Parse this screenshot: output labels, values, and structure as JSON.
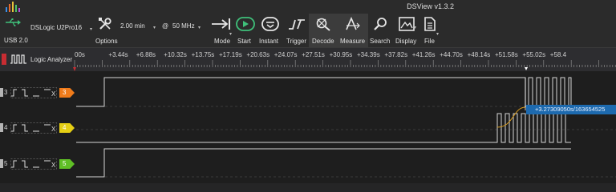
{
  "window": {
    "title": "DSView v1.3.2"
  },
  "device": {
    "name": "DSLogic U2Pro16",
    "connection": "USB 2.0"
  },
  "toolbar": {
    "options_label": "Options",
    "duration": "2.00 min",
    "at_sign": "@",
    "sample_rate": "50 MHz",
    "mode_label": "Mode",
    "start_label": "Start",
    "instant_label": "Instant",
    "trigger_label": "Trigger",
    "decode_label": "Decode",
    "measure_label": "Measure",
    "search_label": "Search",
    "display_label": "Display",
    "file_label": "File"
  },
  "panel": {
    "title": "Logic Analyzer"
  },
  "ruler": {
    "ticks": [
      "00s",
      "+3.44s",
      "+6.88s",
      "+10.32s",
      "+13.75s",
      "+17.19s",
      "+20.63s",
      "+24.07s",
      "+27.51s",
      "+30.95s",
      "+34.39s",
      "+37.82s",
      "+41.26s",
      "+44.70s",
      "+48.14s",
      "+51.58s",
      "+55.02s",
      "+58.4"
    ]
  },
  "channels": [
    {
      "index": "3",
      "tag": "3",
      "color": "#f07b1a"
    },
    {
      "index": "4",
      "tag": "4",
      "color": "#e6cf14"
    },
    {
      "index": "5",
      "tag": "5",
      "color": "#5fbf25"
    }
  ],
  "cursor": {
    "measurement": "+3.27309050s/163654525"
  },
  "colors": {
    "accent": "#1d6aaf",
    "start_green": "#3fc07a",
    "marker_red": "#c82c32",
    "wave": "#d6d6d6"
  }
}
